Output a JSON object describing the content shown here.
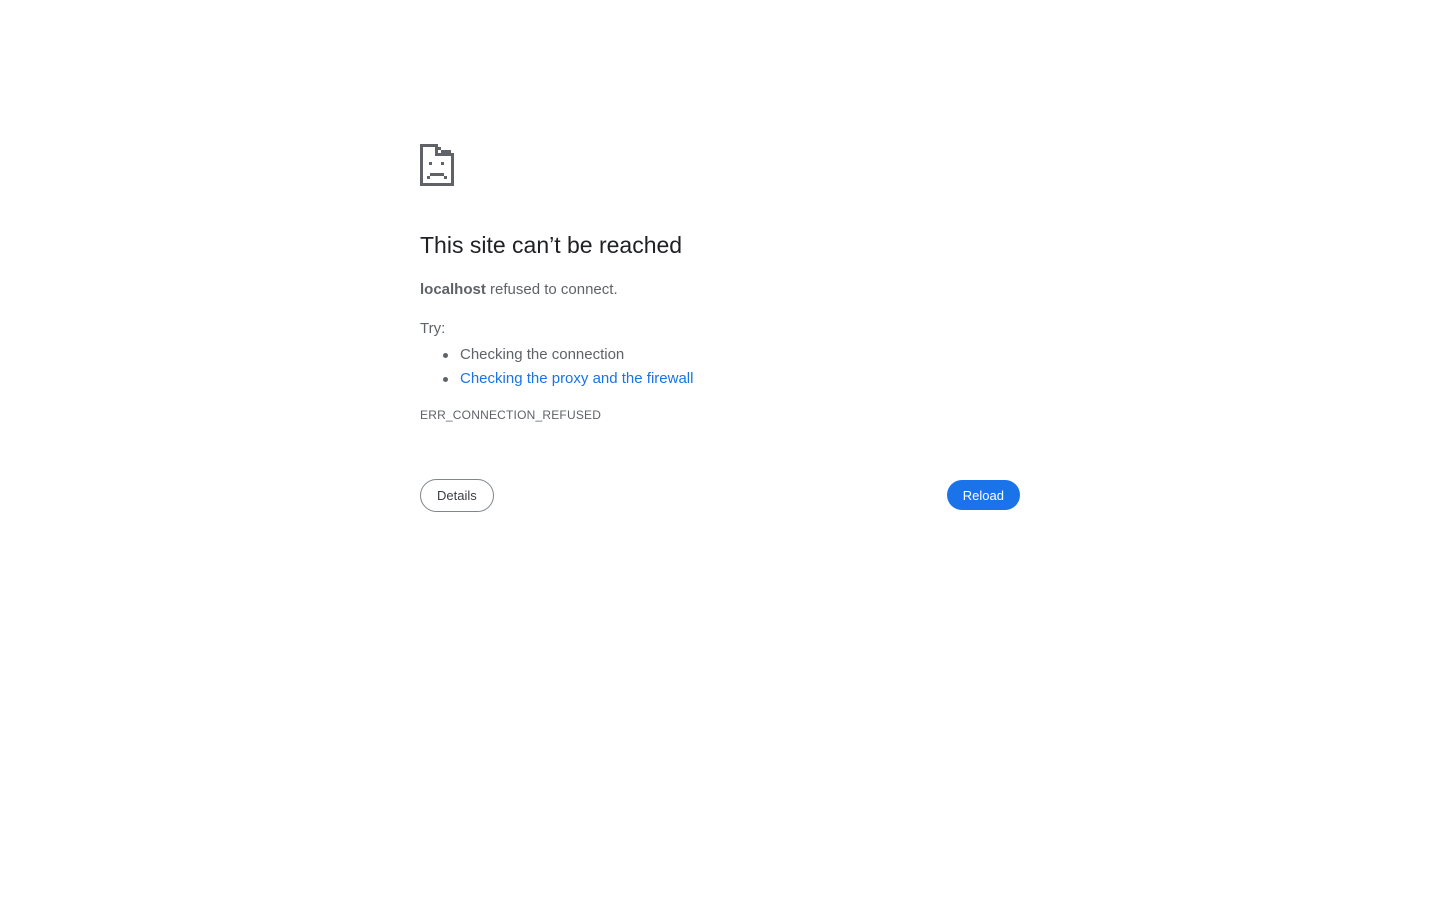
{
  "error_page": {
    "title": "This site can’t be reached",
    "host": "localhost",
    "message": "refused to connect.",
    "try_label": "Try:",
    "suggestions": [
      {
        "text": "Checking the connection",
        "is_link": false
      },
      {
        "text": "Checking the proxy and the firewall",
        "is_link": true
      }
    ],
    "error_code": "ERR_CONNECTION_REFUSED",
    "details_label": "Details",
    "reload_label": "Reload",
    "icon": "sad-document-icon"
  },
  "colors": {
    "accent": "#1a73e8",
    "title_text": "#202124",
    "body_text": "#5f6368",
    "background": "#ffffff"
  }
}
